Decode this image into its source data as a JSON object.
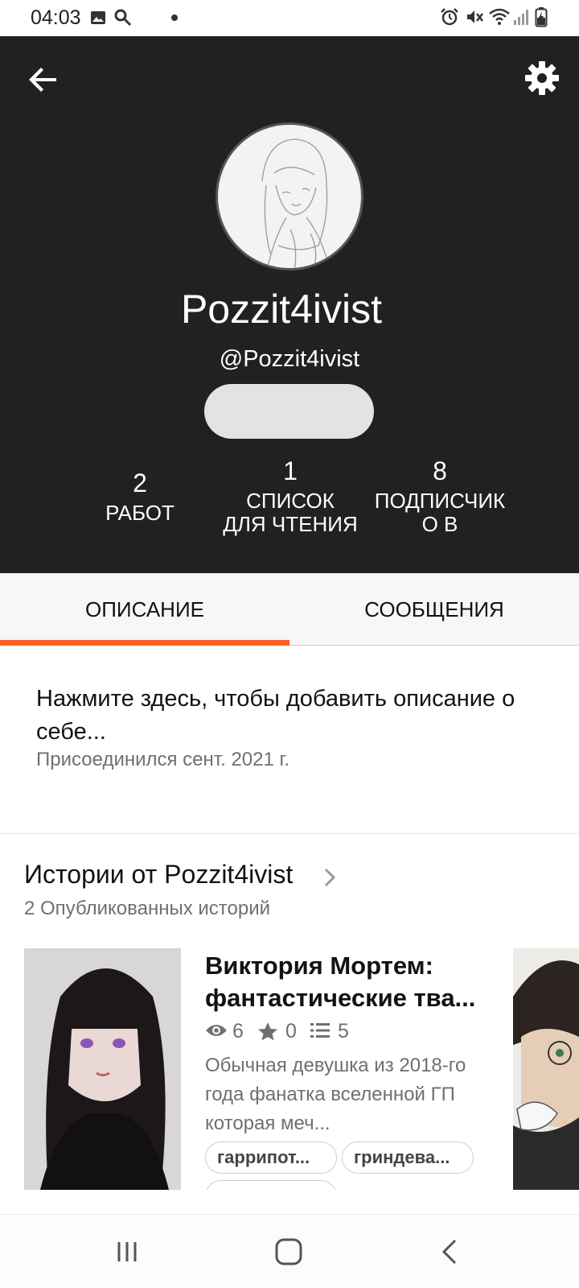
{
  "status_bar": {
    "time": "04:03",
    "left_icons": [
      "image-icon",
      "search-icon",
      "dot-icon"
    ],
    "right_icons": [
      "alarm-icon",
      "mute-icon",
      "wifi-icon",
      "signal-icon",
      "battery-icon"
    ]
  },
  "header": {
    "back_icon": "arrow-left-icon",
    "settings_icon": "gear-icon",
    "display_name": "Pozzit4ivist",
    "username": "@Pozzit4ivist",
    "stats": [
      {
        "value": "2",
        "label": "РАБОТ"
      },
      {
        "value": "1",
        "label": "СПИСОК ДЛЯ ЧТЕНИЯ"
      },
      {
        "value": "8",
        "label": "ПОДПИСЧИКО В"
      }
    ]
  },
  "tabs": {
    "items": [
      {
        "label": "ОПИСАНИЕ",
        "active": true
      },
      {
        "label": "СООБЩЕНИЯ",
        "active": false
      }
    ],
    "accent_color": "#ff6122"
  },
  "about": {
    "placeholder": "Нажмите здесь, чтобы добавить описание о себе...",
    "joined": "Присоединился сент. 2021 г."
  },
  "stories": {
    "title": "Истории от Pozzit4ivist",
    "count": "2 Опубликованных историй",
    "items": [
      {
        "title": "Виктория Мортем: фантастические тва...",
        "views": "6",
        "votes": "0",
        "parts": "5",
        "description": "Обычная девушка из 2018-го года фанатка вселенной ГП которая меч...",
        "tags": [
          "гаррипот...",
          "гриндева..."
        ]
      }
    ]
  },
  "colors": {
    "header_bg": "#222023",
    "accent": "#ff6122"
  },
  "navbar": {
    "icons": [
      "recent-apps-icon",
      "home-icon",
      "back-nav-icon"
    ]
  }
}
